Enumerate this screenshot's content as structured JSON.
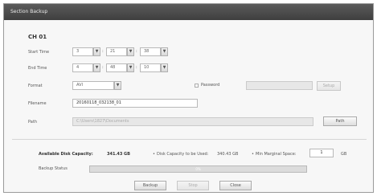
{
  "window": {
    "title": "Section Backup"
  },
  "channel": {
    "label": "CH 01"
  },
  "start_time": {
    "label": "Start Time",
    "hour": "3",
    "minute": "21",
    "second": "38"
  },
  "end_time": {
    "label": "End Time",
    "hour": "4",
    "minute": "48",
    "second": "10"
  },
  "format": {
    "label": "Format",
    "value": "AVI"
  },
  "password": {
    "label": "Password",
    "value": "",
    "setup_label": "Setup"
  },
  "filename": {
    "label": "Filename",
    "value": "20160118_032138_01"
  },
  "path": {
    "label": "Path",
    "value": "C:\\Users\\1827\\Documents",
    "button_label": "Path"
  },
  "disk": {
    "available_label": "Available Disk Capacity:",
    "available_value": "341.43 GB",
    "to_be_used_label": "Disk Capacity to be Used:",
    "to_be_used_value": "340.43 GB",
    "min_marginal_label": "Min Marginal Space:",
    "min_marginal_value": "1",
    "min_marginal_unit": "GB"
  },
  "backup_status": {
    "label": "Backup Status",
    "progress_percent": 0,
    "progress_text": "0%"
  },
  "buttons": {
    "backup": "Backup",
    "stop": "Stop",
    "close": "Close"
  },
  "icons": {
    "spin_arrow": "▼",
    "dropdown_arrow": "▼"
  }
}
